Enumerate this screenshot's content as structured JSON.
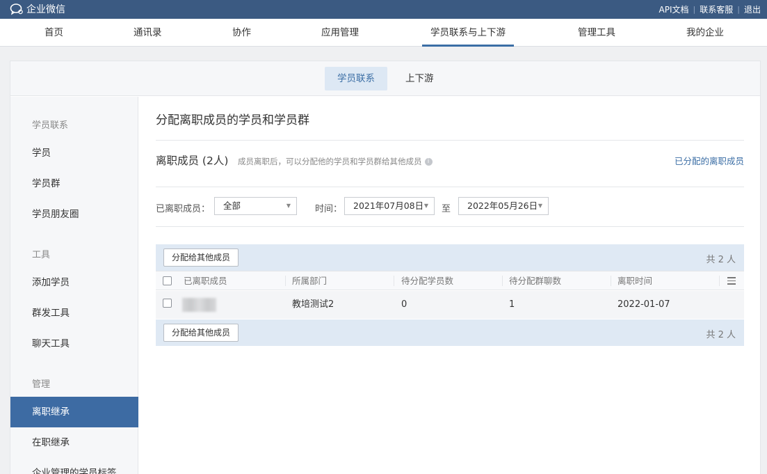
{
  "app": {
    "name": "企业微信"
  },
  "top_links": {
    "api_docs": "API文档",
    "contact_service": "联系客服",
    "logout": "退出",
    "separator": "|"
  },
  "main_nav": [
    {
      "label": "首页",
      "active": false
    },
    {
      "label": "通讯录",
      "active": false
    },
    {
      "label": "协作",
      "active": false
    },
    {
      "label": "应用管理",
      "active": false
    },
    {
      "label": "学员联系与上下游",
      "active": true
    },
    {
      "label": "管理工具",
      "active": false
    },
    {
      "label": "我的企业",
      "active": false
    }
  ],
  "sub_tabs": [
    {
      "label": "学员联系",
      "active": true
    },
    {
      "label": "上下游",
      "active": false
    }
  ],
  "sidebar": {
    "sections": [
      {
        "title": "学员联系",
        "items": [
          {
            "label": "学员"
          },
          {
            "label": "学员群"
          },
          {
            "label": "学员朋友圈"
          }
        ]
      },
      {
        "title": "工具",
        "items": [
          {
            "label": "添加学员"
          },
          {
            "label": "群发工具"
          },
          {
            "label": "聊天工具"
          }
        ]
      },
      {
        "title": "管理",
        "items": [
          {
            "label": "离职继承",
            "active": true
          },
          {
            "label": "在职继承"
          },
          {
            "label": "企业管理的学员标签"
          }
        ]
      }
    ]
  },
  "content": {
    "title": "分配离职成员的学员和学员群",
    "section_title": "离职成员 (2人)",
    "section_desc": "成员离职后，可以分配他的学员和学员群给其他成员",
    "info_icon": "i",
    "assigned_link": "已分配的离职成员",
    "filters": {
      "member_label": "已离职成员：",
      "member_value": "全部",
      "time_label": "时间：",
      "start_date": "2021年07月08日",
      "to_label": "至",
      "end_date": "2022年05月26日"
    },
    "table": {
      "assign_button": "分配给其他成员",
      "total": "共 2 人",
      "columns": [
        "已离职成员",
        "所属部门",
        "待分配学员数",
        "待分配群聊数",
        "离职时间"
      ],
      "rows": [
        {
          "name": "",
          "department": "教培测试2",
          "pending_students": "0",
          "pending_groups": "1",
          "leave_time": "2022-01-07"
        }
      ]
    }
  },
  "colors": {
    "topbar": "#3b5a82",
    "accent": "#3b6ea5",
    "sidebar_active": "#3d6ba3",
    "table_bar": "#dfe9f4"
  },
  "icons": {
    "logo": "wecom-chat-icon",
    "caret": "caret-down-icon",
    "columns": "column-settings-icon"
  }
}
